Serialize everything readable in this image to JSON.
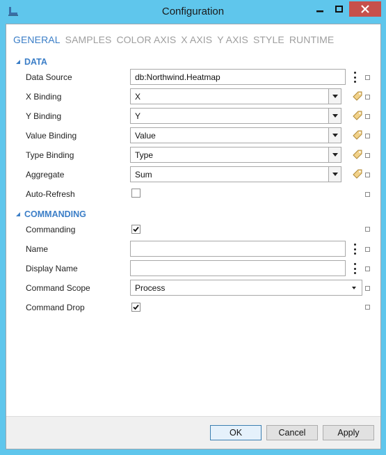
{
  "window": {
    "title": "Configuration"
  },
  "tabs": [
    {
      "label": "GENERAL",
      "active": true
    },
    {
      "label": "SAMPLES",
      "active": false
    },
    {
      "label": "COLOR AXIS",
      "active": false
    },
    {
      "label": "X AXIS",
      "active": false
    },
    {
      "label": "Y AXIS",
      "active": false
    },
    {
      "label": "STYLE",
      "active": false
    },
    {
      "label": "RUNTIME",
      "active": false
    }
  ],
  "data_section": {
    "title": "DATA",
    "data_source": {
      "label": "Data Source",
      "value": "db:Northwind.Heatmap"
    },
    "x_binding": {
      "label": "X Binding",
      "value": "X"
    },
    "y_binding": {
      "label": "Y Binding",
      "value": "Y"
    },
    "value_binding": {
      "label": "Value Binding",
      "value": "Value"
    },
    "type_binding": {
      "label": "Type Binding",
      "value": "Type"
    },
    "aggregate": {
      "label": "Aggregate",
      "value": "Sum"
    },
    "auto_refresh": {
      "label": "Auto-Refresh",
      "checked": false
    }
  },
  "commanding_section": {
    "title": "COMMANDING",
    "commanding": {
      "label": "Commanding",
      "checked": true
    },
    "name": {
      "label": "Name",
      "value": ""
    },
    "display_name": {
      "label": "Display Name",
      "value": ""
    },
    "command_scope": {
      "label": "Command Scope",
      "value": "Process"
    },
    "command_drop": {
      "label": "Command Drop",
      "checked": true
    }
  },
  "footer": {
    "ok": "OK",
    "cancel": "Cancel",
    "apply": "Apply"
  },
  "colors": {
    "title_bar": "#5fc6ec",
    "close_button": "#c7504b",
    "accent": "#3b7ec7"
  }
}
